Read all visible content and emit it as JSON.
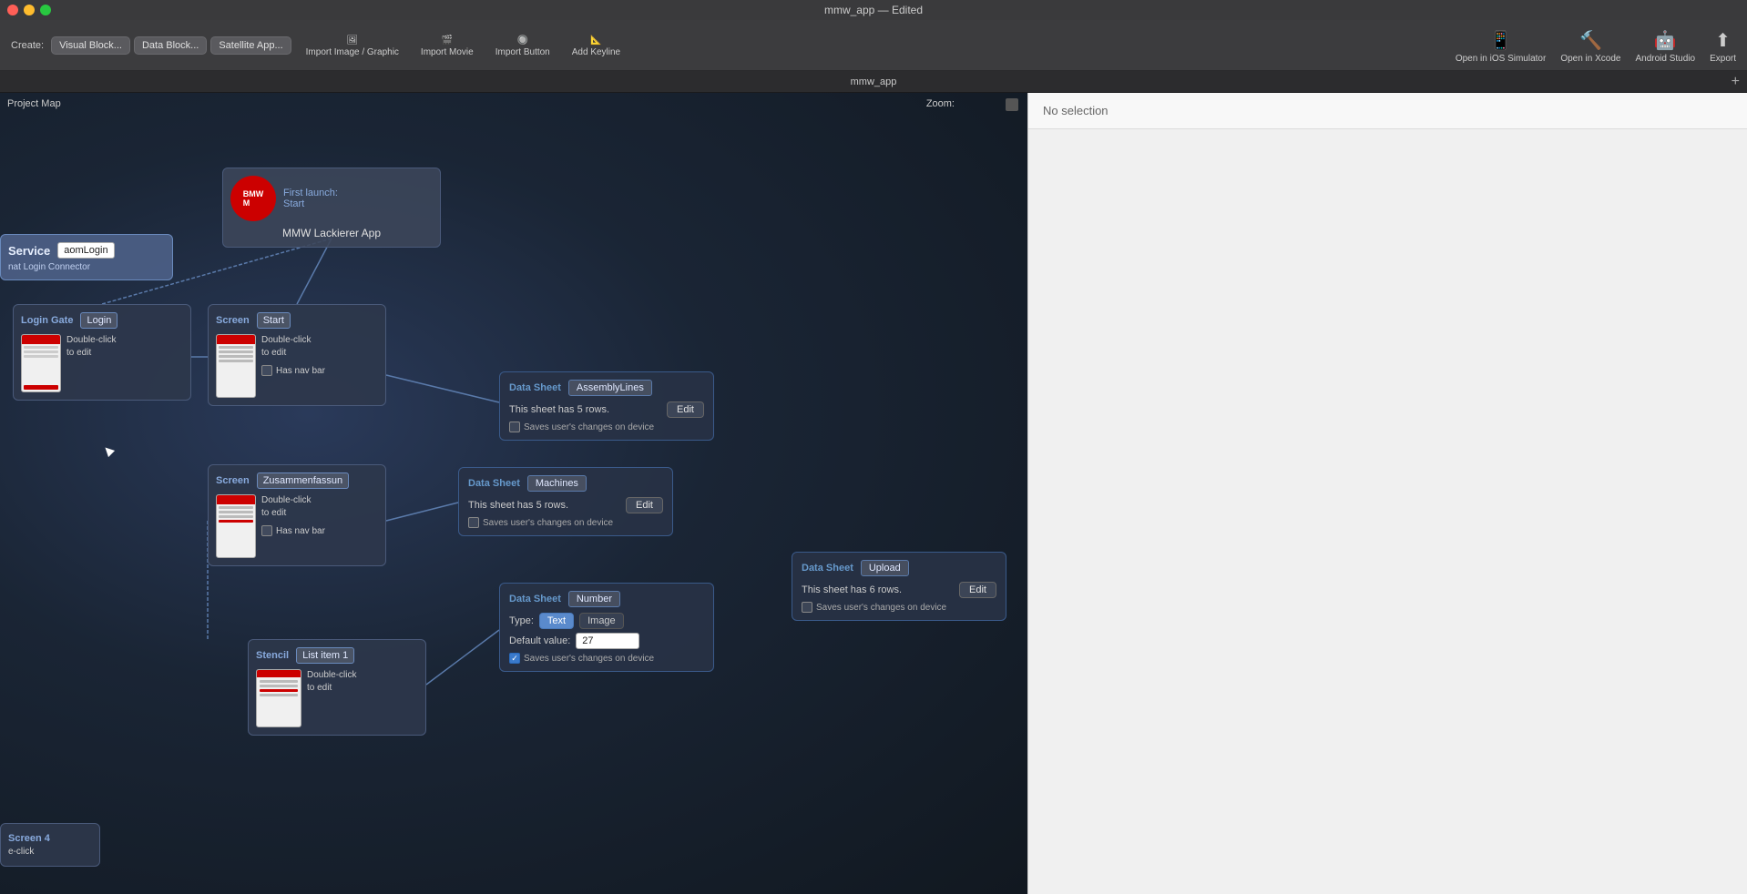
{
  "window": {
    "title": "mmw_app — Edited",
    "tab_title": "mmw_app"
  },
  "title_bar": {
    "close": "●",
    "minimize": "●",
    "maximize": "●"
  },
  "toolbar": {
    "create_label": "Create:",
    "btn_visual_block": "Visual Block...",
    "btn_data_block": "Data Block...",
    "btn_satellite_app": "Satellite App...",
    "import_image_label": "Import Image / Graphic",
    "import_movie_label": "Import Movie",
    "import_button_label": "Import Button",
    "add_keyline_label": "Add Keyline",
    "open_ios_label": "Open in iOS Simulator",
    "open_xcode_label": "Open in Xcode",
    "android_studio_label": "Android Studio",
    "export_label": "Export"
  },
  "canvas": {
    "project_map_label": "Project Map",
    "zoom_label": "Zoom:"
  },
  "right_panel": {
    "no_selection": "No selection"
  },
  "cards": {
    "mmw": {
      "first_launch_label": "First launch:",
      "start_label": "Start",
      "app_name": "MMW Lackierer App"
    },
    "service": {
      "type_label": "Service",
      "name": "aomLogin",
      "subtext": "nat Login Connector"
    },
    "login_gate": {
      "type_label": "Login Gate",
      "name": "Login",
      "edit_text": "Double-click\nto edit"
    },
    "screen_start": {
      "type_label": "Screen",
      "name": "Start",
      "edit_text": "Double-click\nto edit",
      "has_nav_bar": "Has nav bar"
    },
    "screen_zusammen": {
      "type_label": "Screen",
      "name": "Zusammenfassun",
      "edit_text": "Double-click\nto edit",
      "has_nav_bar": "Has nav bar"
    },
    "data_sheet_assembly": {
      "type_label": "Data Sheet",
      "name": "AssemblyLines",
      "rows_text": "This sheet has 5 rows.",
      "edit_btn": "Edit",
      "saves_text": "Saves user's changes on device"
    },
    "data_sheet_machines": {
      "type_label": "Data Sheet",
      "name": "Machines",
      "rows_text": "This sheet has 5 rows.",
      "edit_btn": "Edit",
      "saves_text": "Saves user's changes on device"
    },
    "data_sheet_upload": {
      "type_label": "Data Sheet",
      "name": "Upload",
      "rows_text": "This sheet has 6 rows.",
      "edit_btn": "Edit",
      "saves_text": "Saves user's changes on device"
    },
    "data_sheet_number": {
      "type_label": "Data Sheet",
      "name": "Number",
      "type_key": "Type:",
      "type_text_btn": "Text",
      "type_image_btn": "Image",
      "default_key": "Default value:",
      "default_value": "27",
      "saves_text": "Saves user's changes on device"
    },
    "stencil": {
      "type_label": "Stencil",
      "name": "List item 1",
      "edit_text": "Double-click\nto edit"
    },
    "screen4": {
      "type_label": "Screen 4",
      "subtext": "e-click"
    }
  }
}
